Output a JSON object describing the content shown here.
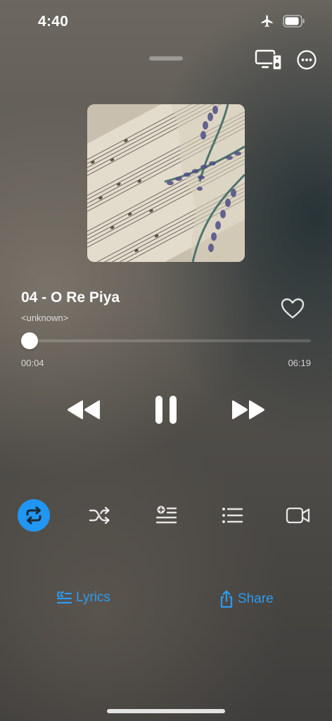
{
  "status_bar": {
    "time": "4:40",
    "icons": [
      "airplane-icon",
      "battery-icon"
    ]
  },
  "header": {
    "icons": [
      "cast-device-icon",
      "more-options-icon"
    ]
  },
  "track": {
    "title": "04 - O Re Piya",
    "artist": "<unknown>",
    "favorite": false
  },
  "progress": {
    "elapsed": "00:04",
    "total": "06:19",
    "fraction": 0.0106
  },
  "controls": {
    "icons": [
      "rewind-icon",
      "pause-icon",
      "fast-forward-icon"
    ]
  },
  "options": {
    "icons": [
      "repeat-icon",
      "shuffle-icon",
      "add-to-queue-icon",
      "playlist-icon",
      "video-icon"
    ],
    "repeat_active": true
  },
  "links": {
    "lyrics": "Lyrics",
    "share": "Share"
  },
  "colors": {
    "accent": "#2196f3",
    "link": "#2d9bf0",
    "progress": "#e0443c"
  }
}
